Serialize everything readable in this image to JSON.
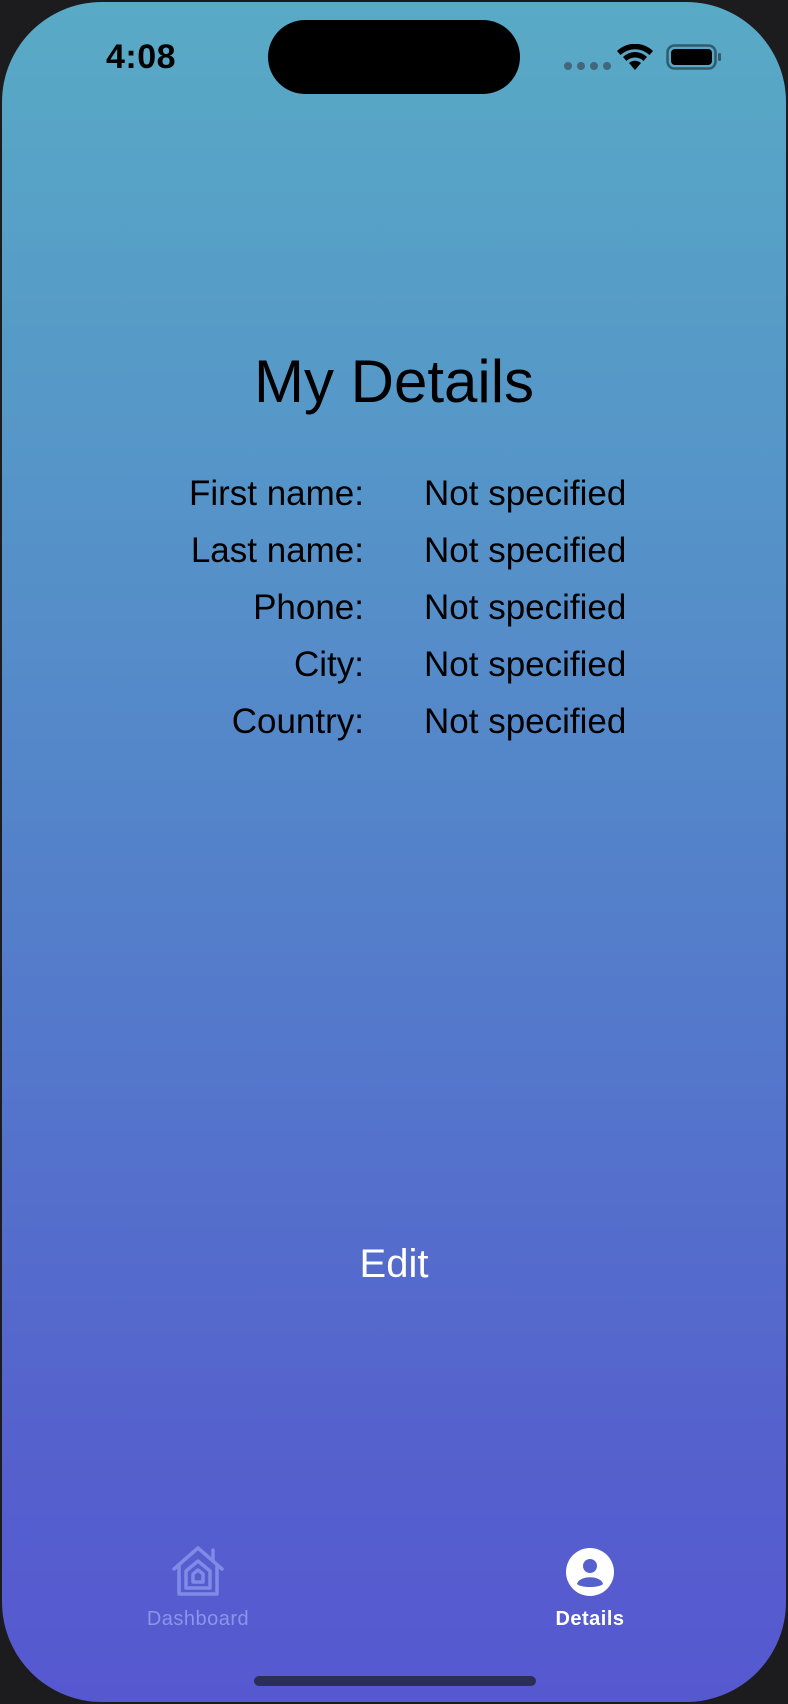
{
  "status_bar": {
    "time": "4:08"
  },
  "page": {
    "title": "My Details",
    "details": [
      {
        "label": "First name:",
        "value": "Not specified"
      },
      {
        "label": "Last name:",
        "value": "Not specified"
      },
      {
        "label": "Phone:",
        "value": "Not specified"
      },
      {
        "label": "City:",
        "value": "Not specified"
      },
      {
        "label": "Country:",
        "value": "Not specified"
      }
    ],
    "edit_label": "Edit"
  },
  "tab_bar": {
    "tabs": [
      {
        "label": "Dashboard",
        "icon": "house-icon",
        "active": false
      },
      {
        "label": "Details",
        "icon": "person-circle-icon",
        "active": true
      }
    ]
  },
  "colors": {
    "gradient_top": "#58aac6",
    "gradient_bottom": "#5658d0",
    "tab_inactive": "#8a96e8",
    "tab_active": "#ffffff"
  }
}
